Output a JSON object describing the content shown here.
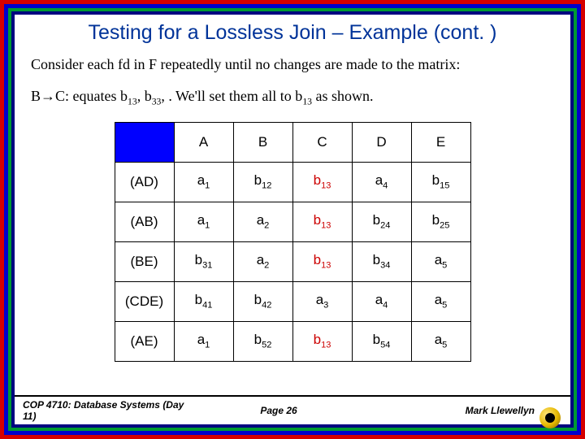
{
  "title": "Testing for a Lossless Join – Example (cont. )",
  "para1": "Consider each fd in F repeatedly until no changes are made to the matrix:",
  "para2_prefix": "B",
  "para2_arrow": "→",
  "para2_after": "C: equates b",
  "para2_s1": "13",
  "para2_mid1": ", b",
  "para2_s2": "33",
  "para2_mid2": ", .  We'll set them all to b",
  "para2_s3": "13",
  "para2_end": " as shown.",
  "headers": [
    "A",
    "B",
    "C",
    "D",
    "E"
  ],
  "rows": [
    {
      "label": "(AD)",
      "cells": [
        {
          "t": "a",
          "s": "1"
        },
        {
          "t": "b",
          "s": "12"
        },
        {
          "t": "b",
          "s": "13",
          "red": true
        },
        {
          "t": "a",
          "s": "4"
        },
        {
          "t": "b",
          "s": "15"
        }
      ]
    },
    {
      "label": "(AB)",
      "cells": [
        {
          "t": "a",
          "s": "1"
        },
        {
          "t": "a",
          "s": "2"
        },
        {
          "t": "b",
          "s": "13",
          "red": true
        },
        {
          "t": "b",
          "s": "24"
        },
        {
          "t": "b",
          "s": "25"
        }
      ]
    },
    {
      "label": "(BE)",
      "cells": [
        {
          "t": "b",
          "s": "31"
        },
        {
          "t": "a",
          "s": "2"
        },
        {
          "t": "b",
          "s": "13",
          "red": true
        },
        {
          "t": "b",
          "s": "34"
        },
        {
          "t": "a",
          "s": "5"
        }
      ]
    },
    {
      "label": "(CDE)",
      "cells": [
        {
          "t": "b",
          "s": "41"
        },
        {
          "t": "b",
          "s": "42"
        },
        {
          "t": "a",
          "s": "3"
        },
        {
          "t": "a",
          "s": "4"
        },
        {
          "t": "a",
          "s": "5"
        }
      ]
    },
    {
      "label": "(AE)",
      "cells": [
        {
          "t": "a",
          "s": "1"
        },
        {
          "t": "b",
          "s": "52"
        },
        {
          "t": "b",
          "s": "13",
          "red": true
        },
        {
          "t": "b",
          "s": "54"
        },
        {
          "t": "a",
          "s": "5"
        }
      ]
    }
  ],
  "footer": {
    "left": "COP 4710: Database Systems  (Day 11)",
    "center": "Page 26",
    "right": "Mark Llewellyn"
  }
}
